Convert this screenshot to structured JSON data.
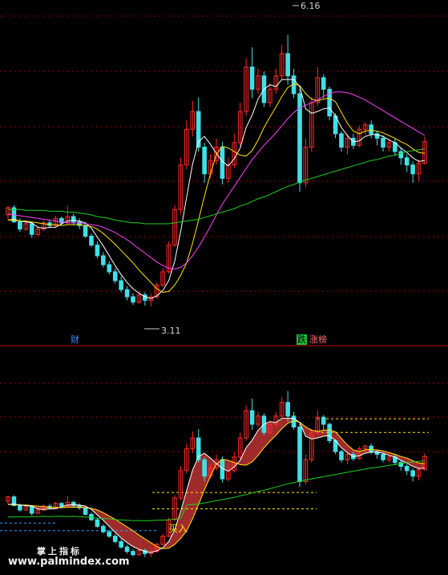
{
  "annotations": {
    "high_price": "6.16",
    "low_price": "3.11",
    "upper_marker_left": "财",
    "upper_marker_mid": "跌",
    "upper_marker_right": "涨榜",
    "buy_signal": "买入",
    "brand": "掌上指标",
    "watermark": "www.palmindex.com"
  },
  "colors": {
    "up": "#ff2a2a",
    "down": "#40e0e8",
    "ma_white": "#ffffff",
    "ma_yellow": "#ffe600",
    "ma_magenta": "#ff40ff",
    "ma_green": "#20d020",
    "ribbon": "#b03030",
    "grid": "#a00000"
  },
  "chart_data": [
    {
      "type": "candlestick",
      "panel": "price",
      "ylim": [
        2.95,
        6.3
      ],
      "high_label": 6.16,
      "low_label": 3.11,
      "candles": [
        [
          4.14,
          4.22,
          4.24,
          4.08
        ],
        [
          4.22,
          4.06,
          4.25,
          4.05
        ],
        [
          4.06,
          3.98,
          4.1,
          3.95
        ],
        [
          3.98,
          4.04,
          4.07,
          3.96
        ],
        [
          4.04,
          3.92,
          4.06,
          3.88
        ],
        [
          3.92,
          3.98,
          4.02,
          3.9
        ],
        [
          3.98,
          4.05,
          4.08,
          3.96
        ],
        [
          4.05,
          4.02,
          4.09,
          3.99
        ],
        [
          4.02,
          4.1,
          4.13,
          4.0
        ],
        [
          4.1,
          4.05,
          4.12,
          4.02
        ],
        [
          4.05,
          4.12,
          4.24,
          4.03
        ],
        [
          4.12,
          4.06,
          4.15,
          4.02
        ],
        [
          4.06,
          4.02,
          4.1,
          3.98
        ],
        [
          4.02,
          3.9,
          4.05,
          3.88
        ],
        [
          3.9,
          3.8,
          3.93,
          3.78
        ],
        [
          3.8,
          3.68,
          3.84,
          3.65
        ],
        [
          3.68,
          3.58,
          3.72,
          3.55
        ],
        [
          3.58,
          3.5,
          3.62,
          3.47
        ],
        [
          3.5,
          3.4,
          3.54,
          3.37
        ],
        [
          3.4,
          3.3,
          3.45,
          3.27
        ],
        [
          3.3,
          3.22,
          3.34,
          3.18
        ],
        [
          3.22,
          3.16,
          3.26,
          3.13
        ],
        [
          3.16,
          3.24,
          3.28,
          3.14
        ],
        [
          3.24,
          3.18,
          3.27,
          3.12
        ],
        [
          3.18,
          3.22,
          3.26,
          3.11
        ],
        [
          3.22,
          3.35,
          3.38,
          3.2
        ],
        [
          3.35,
          3.5,
          3.54,
          3.33
        ],
        [
          3.5,
          3.8,
          3.84,
          3.48
        ],
        [
          3.8,
          4.2,
          4.25,
          3.78
        ],
        [
          4.2,
          4.7,
          4.78,
          4.15
        ],
        [
          4.7,
          5.1,
          5.2,
          4.65
        ],
        [
          5.1,
          5.3,
          5.42,
          5.02
        ],
        [
          5.3,
          4.9,
          5.46,
          4.85
        ],
        [
          4.9,
          4.6,
          4.95,
          4.5
        ],
        [
          4.6,
          4.75,
          4.82,
          4.55
        ],
        [
          4.75,
          4.9,
          5.0,
          4.7
        ],
        [
          4.9,
          4.55,
          4.96,
          4.48
        ],
        [
          4.55,
          4.7,
          4.78,
          4.5
        ],
        [
          4.7,
          4.95,
          5.05,
          4.66
        ],
        [
          4.95,
          5.3,
          5.4,
          4.9
        ],
        [
          5.3,
          5.8,
          5.9,
          5.25
        ],
        [
          5.8,
          5.55,
          6.02,
          5.45
        ],
        [
          5.55,
          5.7,
          5.78,
          5.5
        ],
        [
          5.7,
          5.4,
          5.75,
          5.35
        ],
        [
          5.4,
          5.55,
          5.62,
          5.35
        ],
        [
          5.55,
          5.7,
          5.78,
          5.5
        ],
        [
          5.7,
          5.95,
          6.05,
          5.65
        ],
        [
          5.95,
          5.7,
          6.16,
          5.6
        ],
        [
          5.7,
          5.5,
          5.78,
          5.45
        ],
        [
          5.5,
          4.5,
          5.55,
          4.4
        ],
        [
          4.5,
          4.9,
          5.0,
          4.45
        ],
        [
          4.9,
          5.4,
          5.46,
          4.85
        ],
        [
          5.4,
          5.68,
          5.8,
          5.36
        ],
        [
          5.68,
          5.55,
          5.72,
          5.45
        ],
        [
          5.55,
          5.25,
          5.58,
          5.2
        ],
        [
          5.25,
          5.05,
          5.28,
          5.0
        ],
        [
          5.05,
          4.9,
          5.08,
          4.85
        ],
        [
          4.9,
          5.0,
          5.05,
          4.82
        ],
        [
          5.0,
          4.92,
          5.05,
          4.88
        ],
        [
          4.92,
          5.1,
          5.14,
          4.9
        ],
        [
          5.1,
          5.15,
          5.18,
          5.04
        ],
        [
          5.15,
          5.05,
          5.2,
          5.0
        ],
        [
          5.05,
          5.0,
          5.08,
          4.92
        ],
        [
          5.0,
          4.9,
          5.03,
          4.85
        ],
        [
          4.9,
          4.95,
          5.0,
          4.85
        ],
        [
          4.95,
          4.85,
          5.0,
          4.8
        ],
        [
          4.85,
          4.78,
          4.9,
          4.7
        ],
        [
          4.78,
          4.7,
          4.82,
          4.62
        ],
        [
          4.7,
          4.6,
          4.74,
          4.5
        ],
        [
          4.6,
          4.72,
          4.76,
          4.52
        ],
        [
          4.72,
          4.96,
          5.02,
          4.7
        ]
      ],
      "series": [
        {
          "name": "MA5",
          "color": "#ffffff",
          "values": [
            4.08,
            4.09,
            4.07,
            4.06,
            4.05,
            4.0,
            3.99,
            4.0,
            4.0,
            4.04,
            4.07,
            4.08,
            4.07,
            4.05,
            3.99,
            3.89,
            3.79,
            3.68,
            3.57,
            3.47,
            3.38,
            3.31,
            3.26,
            3.22,
            3.2,
            3.23,
            3.29,
            3.4,
            3.62,
            3.95,
            4.34,
            4.71,
            4.96,
            5.02,
            4.93,
            4.83,
            4.74,
            4.69,
            4.77,
            4.89,
            5.12,
            5.26,
            5.44,
            5.55,
            5.6,
            5.58,
            5.66,
            5.66,
            5.66,
            5.58,
            5.33,
            5.28,
            5.3,
            5.33,
            5.34,
            5.25,
            5.12,
            5.03,
            4.96,
            4.97,
            5.02,
            5.04,
            5.04,
            5.02,
            4.98,
            4.95,
            4.89,
            4.84,
            4.78,
            4.74,
            4.75
          ]
        },
        {
          "name": "MA10",
          "color": "#ffe600",
          "values": [
            4.08,
            4.08,
            4.07,
            4.07,
            4.06,
            4.05,
            4.04,
            4.03,
            4.03,
            4.02,
            4.03,
            4.03,
            4.03,
            4.02,
            4.01,
            3.98,
            3.93,
            3.87,
            3.81,
            3.74,
            3.67,
            3.6,
            3.52,
            3.45,
            3.38,
            3.31,
            3.27,
            3.28,
            3.35,
            3.46,
            3.6,
            3.82,
            4.08,
            4.35,
            4.6,
            4.82,
            4.91,
            4.89,
            4.85,
            4.81,
            4.8,
            4.86,
            4.98,
            5.12,
            5.24,
            5.35,
            5.47,
            5.57,
            5.61,
            5.59,
            5.5,
            5.44,
            5.42,
            5.44,
            5.45,
            5.41,
            5.29,
            5.17,
            5.08,
            5.05,
            5.08,
            5.09,
            5.08,
            5.06,
            5.03,
            5.0,
            4.96,
            4.93,
            4.88,
            4.84,
            4.83
          ]
        },
        {
          "name": "MA20",
          "color": "#ff40ff",
          "values": [
            4.15,
            4.14,
            4.13,
            4.12,
            4.11,
            4.1,
            4.09,
            4.08,
            4.07,
            4.06,
            4.05,
            4.05,
            4.05,
            4.04,
            4.03,
            4.02,
            4.0,
            3.97,
            3.94,
            3.9,
            3.86,
            3.81,
            3.76,
            3.71,
            3.66,
            3.61,
            3.57,
            3.54,
            3.53,
            3.55,
            3.6,
            3.68,
            3.78,
            3.89,
            4.01,
            4.14,
            4.26,
            4.36,
            4.46,
            4.56,
            4.66,
            4.76,
            4.84,
            4.92,
            4.99,
            5.06,
            5.14,
            5.22,
            5.29,
            5.34,
            5.37,
            5.4,
            5.43,
            5.47,
            5.5,
            5.52,
            5.52,
            5.51,
            5.49,
            5.46,
            5.43,
            5.39,
            5.35,
            5.31,
            5.27,
            5.23,
            5.19,
            5.15,
            5.11,
            5.07,
            5.03
          ]
        },
        {
          "name": "MA60",
          "color": "#20d020",
          "values": [
            4.2,
            4.2,
            4.2,
            4.19,
            4.19,
            4.19,
            4.19,
            4.18,
            4.18,
            4.18,
            4.17,
            4.17,
            4.16,
            4.15,
            4.14,
            4.12,
            4.11,
            4.1,
            4.08,
            4.07,
            4.06,
            4.05,
            4.05,
            4.04,
            4.04,
            4.04,
            4.04,
            4.04,
            4.05,
            4.06,
            4.07,
            4.08,
            4.09,
            4.11,
            4.13,
            4.15,
            4.17,
            4.19,
            4.21,
            4.24,
            4.26,
            4.29,
            4.32,
            4.34,
            4.37,
            4.4,
            4.43,
            4.46,
            4.48,
            4.51,
            4.53,
            4.55,
            4.57,
            4.59,
            4.61,
            4.63,
            4.65,
            4.67,
            4.69,
            4.71,
            4.73,
            4.75,
            4.76,
            4.78,
            4.8,
            4.81,
            4.83,
            4.85,
            4.86,
            4.87,
            4.88
          ]
        }
      ]
    },
    {
      "type": "indicator",
      "panel": "indicator",
      "note": "same candle series redrawn with a shaded ribbon between two average lines",
      "ylim": [
        2.95,
        6.3
      ],
      "reference_levels": [
        3.74,
        3.6,
        5.4,
        5.65,
        4.3,
        4.0
      ]
    }
  ]
}
